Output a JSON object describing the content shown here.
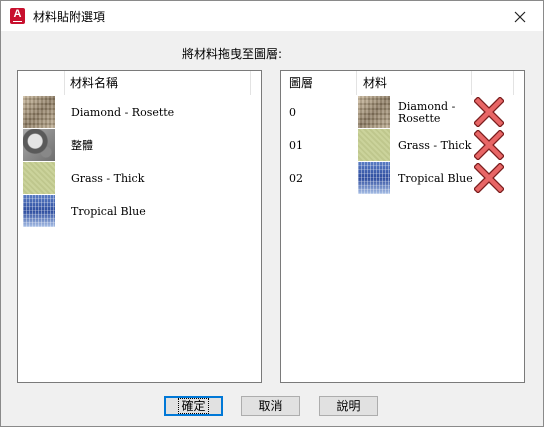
{
  "window": {
    "title": "材料貼附選項"
  },
  "instruction": "將材料拖曳至圖層:",
  "materials_list": {
    "header": "材料名稱",
    "items": [
      {
        "name": "Diamond - Rosette",
        "swatch": "diamond-rosette"
      },
      {
        "name": "整體",
        "swatch": "global"
      },
      {
        "name": "Grass - Thick",
        "swatch": "grass-thick"
      },
      {
        "name": "Tropical Blue",
        "swatch": "tropical-blue"
      }
    ]
  },
  "layers_list": {
    "headers": {
      "layer": "圖層",
      "material": "材料"
    },
    "rows": [
      {
        "layer": "0",
        "material_line1": "Diamond -",
        "material_line2": "Rosette",
        "swatch": "diamond-rosette",
        "remove_icon": "red-x-icon"
      },
      {
        "layer": "01",
        "material_line1": "Grass - Thick",
        "material_line2": "",
        "swatch": "grass-thick",
        "remove_icon": "red-x-icon"
      },
      {
        "layer": "02",
        "material_line1": "Tropical Blue",
        "material_line2": "",
        "swatch": "tropical-blue",
        "remove_icon": "red-x-icon"
      }
    ]
  },
  "buttons": {
    "ok": "確定",
    "cancel": "取消",
    "help": "說明"
  },
  "colors": {
    "app_icon": "#c8102e",
    "remove_icon": "#e04a4a",
    "default_button_border": "#0078d7"
  }
}
